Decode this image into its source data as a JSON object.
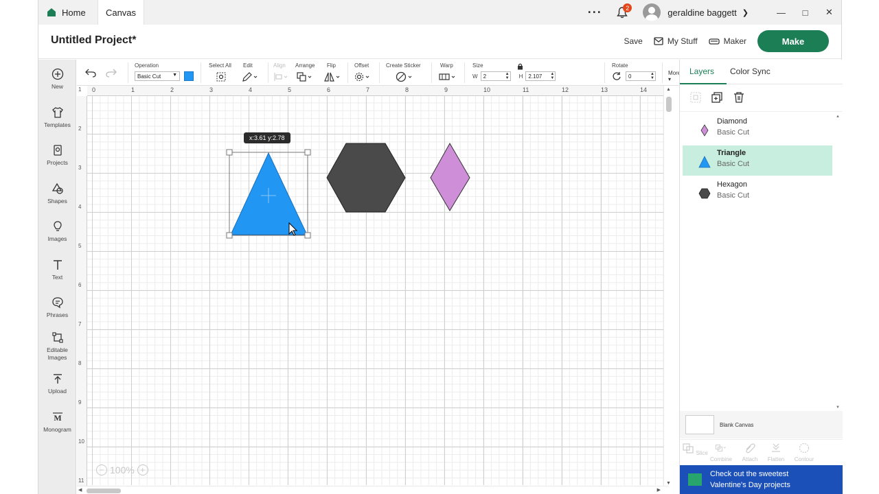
{
  "titlebar": {
    "tab_home": "Home",
    "tab_canvas": "Canvas",
    "notification_count": "2",
    "username": "geraldine baggett"
  },
  "header": {
    "project_title": "Untitled Project*",
    "save": "Save",
    "my_stuff": "My Stuff",
    "maker": "Maker",
    "make": "Make"
  },
  "sidebar": {
    "items": [
      {
        "label": "New",
        "icon": "plus-circle-icon"
      },
      {
        "label": "Templates",
        "icon": "shirt-icon"
      },
      {
        "label": "Projects",
        "icon": "projects-icon"
      },
      {
        "label": "Shapes",
        "icon": "shapes-icon"
      },
      {
        "label": "Images",
        "icon": "bulb-icon"
      },
      {
        "label": "Text",
        "icon": "text-icon"
      },
      {
        "label": "Phrases",
        "icon": "speech-bubble-icon"
      },
      {
        "label": "Editable Images",
        "icon": "editable-images-icon"
      },
      {
        "label": "Upload",
        "icon": "upload-icon"
      },
      {
        "label": "Monogram",
        "icon": "monogram-icon"
      }
    ]
  },
  "toolbar": {
    "operation_label": "Operation",
    "operation_value": "Basic Cut",
    "operation_color": "#2196f3",
    "select_all": "Select All",
    "edit": "Edit",
    "align": "Align",
    "arrange": "Arrange",
    "flip": "Flip",
    "offset": "Offset",
    "create_sticker": "Create Sticker",
    "warp": "Warp",
    "size": "Size",
    "w_label": "W",
    "w_value": "2",
    "h_label": "H",
    "h_value": "2.107",
    "rotate": "Rotate",
    "rotate_value": "0",
    "more": "More"
  },
  "canvas": {
    "ruler_top": [
      "0",
      "1",
      "2",
      "3",
      "4",
      "5",
      "6",
      "7",
      "8",
      "9",
      "10",
      "11",
      "12",
      "13",
      "14"
    ],
    "ruler_left": [
      "1",
      "2",
      "3",
      "4",
      "5",
      "6",
      "7",
      "8",
      "9",
      "10",
      "11"
    ],
    "coord_tooltip": "x:3.61 y:2.78",
    "zoom": "100%",
    "shapes": {
      "triangle_color": "#2196f3",
      "hexagon_color": "#4a4a4a",
      "diamond_color": "#cf8fd8"
    }
  },
  "panel": {
    "tab_layers": "Layers",
    "tab_color_sync": "Color Sync",
    "layers": [
      {
        "name": "Diamond",
        "op": "Basic Cut",
        "color": "#cf8fd8",
        "shape": "diamond"
      },
      {
        "name": "Triangle",
        "op": "Basic Cut",
        "color": "#2196f3",
        "shape": "triangle"
      },
      {
        "name": "Hexagon",
        "op": "Basic Cut",
        "color": "#4a4a4a",
        "shape": "hexagon"
      }
    ],
    "blank_canvas": "Blank Canvas",
    "actions": [
      "Slice",
      "Combine",
      "Attach",
      "Flatten",
      "Contour"
    ],
    "promo_line1": "Check out the sweetest",
    "promo_line2": "Valentine's Day projects"
  }
}
